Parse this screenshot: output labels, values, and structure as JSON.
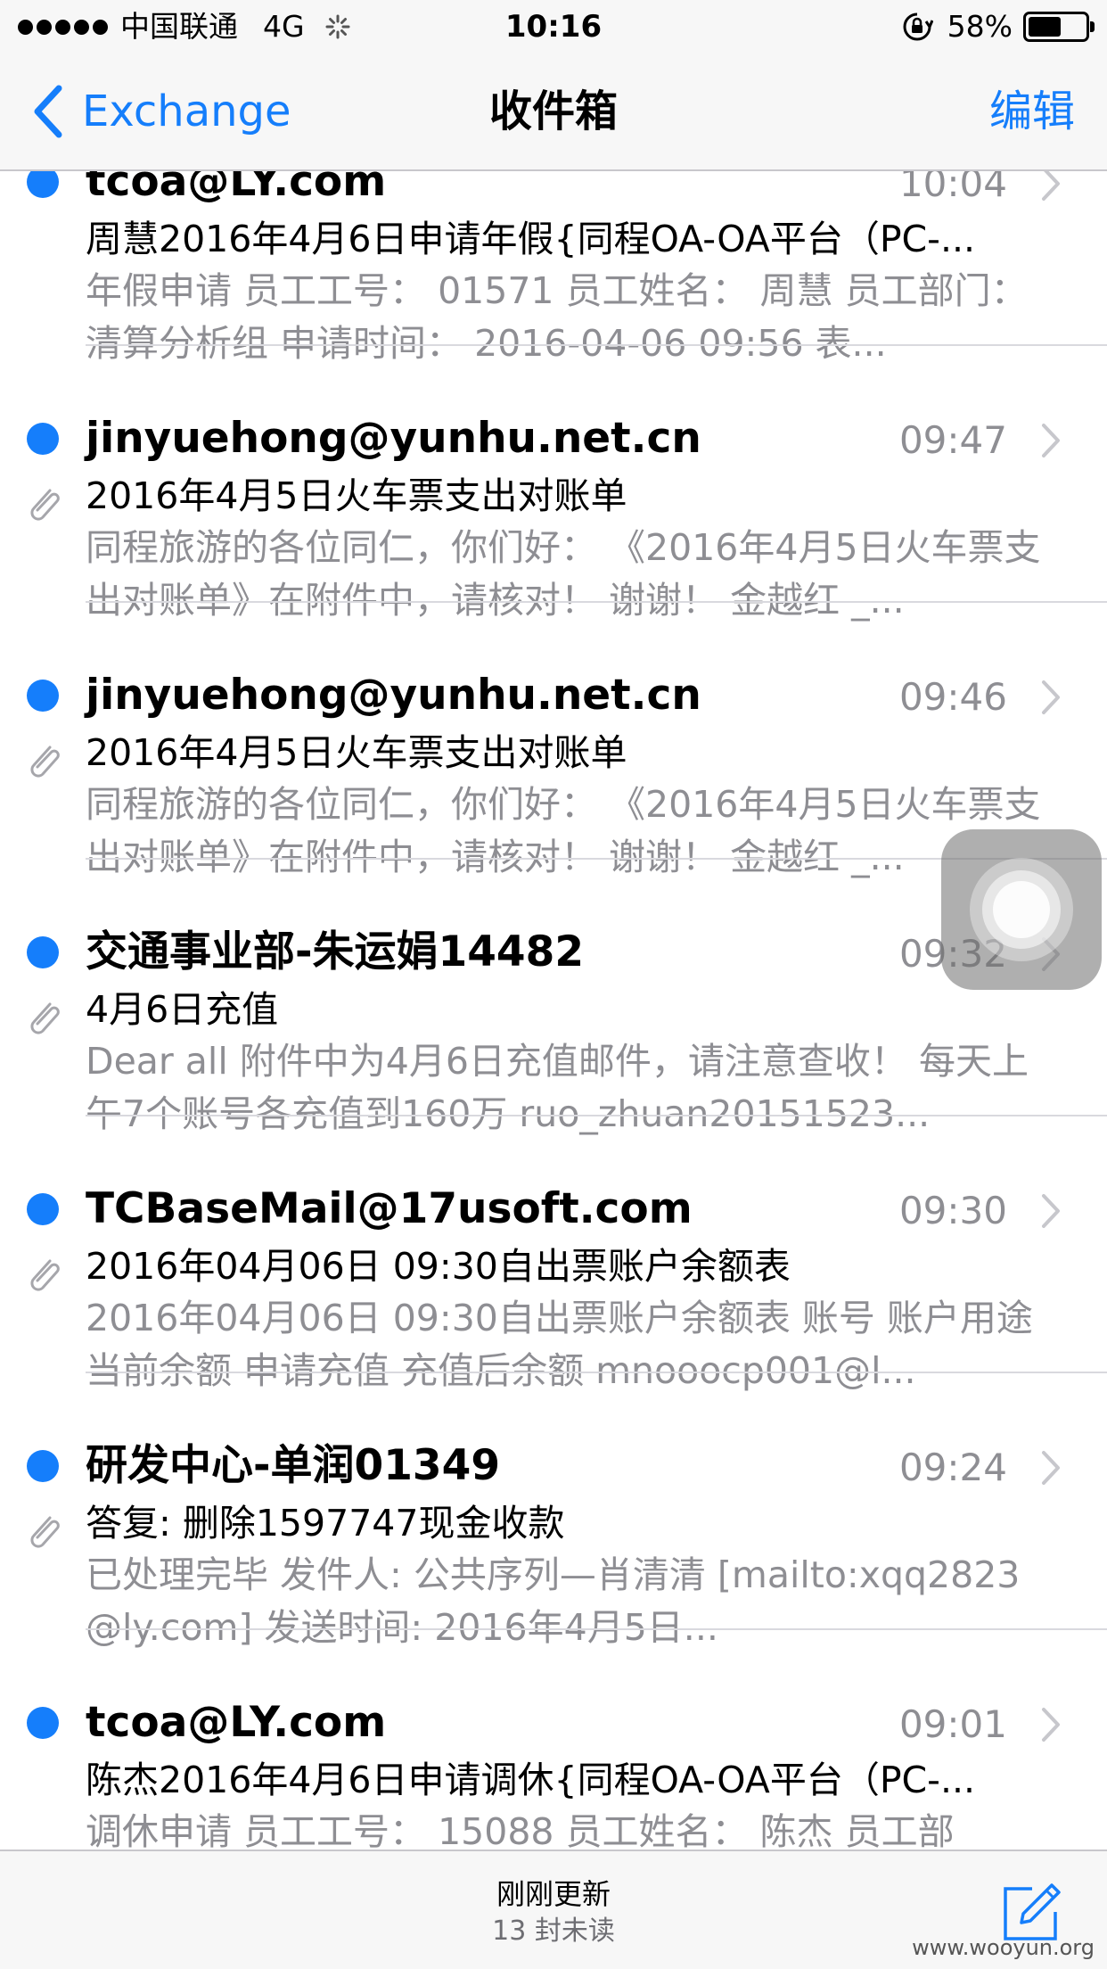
{
  "status_bar": {
    "carrier": "中国联通",
    "network": "4G",
    "time": "10:16",
    "battery": "58%",
    "battery_level": 0.58
  },
  "nav": {
    "back_label": "Exchange",
    "title": "收件箱",
    "edit_label": "编辑"
  },
  "mails": [
    {
      "sender": "tcoa@LY.com",
      "time": "10:04",
      "subject": "周慧2016年4月6日申请年假{同程OA-OA平台（PC-...",
      "preview": "年假申请 员工工号： 01571 员工姓名： 周慧 员工部门： 清算分析组 申请时间： 2016-04-06 09:56 表...",
      "unread": true,
      "attachment": false
    },
    {
      "sender": "jinyuehong@yunhu.net.cn",
      "time": "09:47",
      "subject": "2016年4月5日火车票支出对账单",
      "preview": "同程旅游的各位同仁，你们好： 《2016年4月5日火车票支出对账单》在附件中，请核对！ 谢谢！ 金越红 _...",
      "unread": true,
      "attachment": true
    },
    {
      "sender": "jinyuehong@yunhu.net.cn",
      "time": "09:46",
      "subject": "2016年4月5日火车票支出对账单",
      "preview": "同程旅游的各位同仁，你们好： 《2016年4月5日火车票支出对账单》在附件中，请核对！ 谢谢！ 金越红 _...",
      "unread": true,
      "attachment": true
    },
    {
      "sender": "交通事业部-朱运娟14482",
      "time": "09:32",
      "subject": " 4月6日充值",
      "preview": "Dear all 附件中为4月6日充值邮件，请注意查收！ 每天上午7个账号各充值到160万 ruo_zhuan20151523...",
      "unread": true,
      "attachment": true
    },
    {
      "sender": "TCBaseMail@17usoft.com",
      "time": "09:30",
      "subject": "2016年04月06日 09:30自出票账户余额表",
      "preview": "2016年04月06日 09:30自出票账户余额表 账号 账户用途 当前余额 申请充值 充值后余额 mnooocp001@l...",
      "unread": true,
      "attachment": true
    },
    {
      "sender": "研发中心-单润01349",
      "time": "09:24",
      "subject": "答复: 删除1597747现金收款",
      "preview": "已处理完毕 发件人: 公共序列—肖清清 [mailto:xqq2823@ly.com] 发送时间: 2016年4月5日...",
      "unread": true,
      "attachment": true
    },
    {
      "sender": "tcoa@LY.com",
      "time": "09:01",
      "subject": "陈杰2016年4月6日申请调休{同程OA-OA平台（PC-...",
      "preview": "调休申请 员工工号： 15088 员工姓名： 陈杰 员工部",
      "unread": true,
      "attachment": false
    }
  ],
  "toolbar": {
    "updated": "刚刚更新",
    "unread_count": "13 封未读",
    "watermark": "www.wooyun.org"
  }
}
